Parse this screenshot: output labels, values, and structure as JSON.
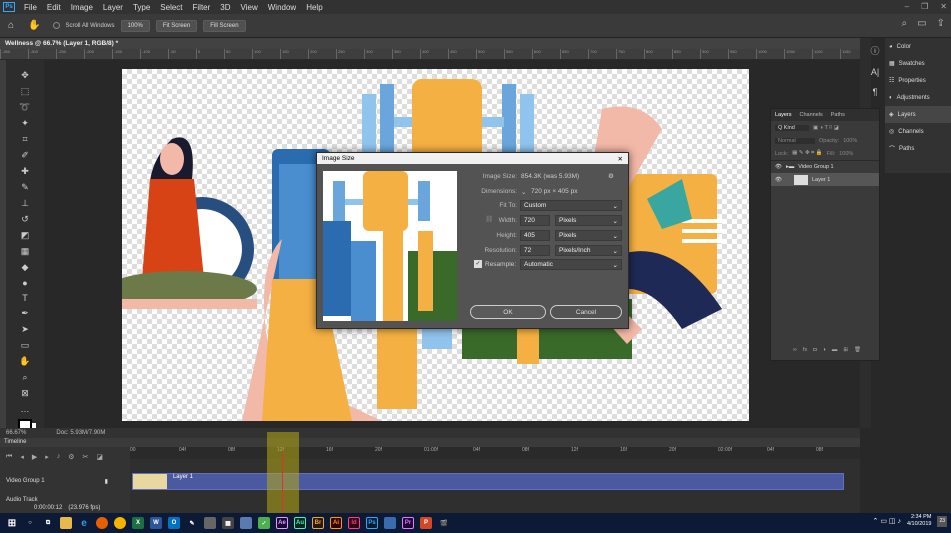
{
  "menubar": {
    "logo": "Ps",
    "items": [
      "File",
      "Edit",
      "Image",
      "Layer",
      "Type",
      "Select",
      "Filter",
      "3D",
      "View",
      "Window",
      "Help"
    ]
  },
  "options": {
    "scroll_all": "Scroll All Windows",
    "zoom_100": "100%",
    "fit_screen": "Fit Screen",
    "fill_screen": "Fill Screen"
  },
  "document": {
    "tab": "Wellness @ 66.7% (Layer 1, RGB/8) *",
    "zoom": "66.67%",
    "doc_info": "Doc: 5.93M/7.90M"
  },
  "ruler_ticks": [
    "-350",
    "-300",
    "-250",
    "-200",
    "-150",
    "-100",
    "-50",
    "0",
    "50",
    "100",
    "150",
    "200",
    "250",
    "300",
    "350",
    "400",
    "450",
    "500",
    "550",
    "600",
    "650",
    "700",
    "750",
    "800",
    "850",
    "900",
    "950",
    "1000",
    "1050",
    "1100",
    "1150",
    "1200",
    "1250",
    "1300",
    "1350",
    "1400",
    "1450",
    "1500",
    "1550",
    "1600",
    "1650",
    "1700",
    "1750",
    "1800",
    "1850",
    "1900",
    "1950",
    "2000",
    "2050",
    "2100",
    "2150",
    "2200"
  ],
  "dialog": {
    "title": "Image Size",
    "image_size_label": "Image Size:",
    "image_size_value": "854.3K (was 5.93M)",
    "dimensions_label": "Dimensions:",
    "dimensions_value": "720 px × 405 px",
    "fit_to_label": "Fit To:",
    "fit_to_value": "Custom",
    "width_label": "Width:",
    "width_value": "720",
    "width_unit": "Pixels",
    "height_label": "Height:",
    "height_value": "405",
    "height_unit": "Pixels",
    "resolution_label": "Resolution:",
    "resolution_value": "72",
    "resolution_unit": "Pixels/Inch",
    "resample_label": "Resample:",
    "resample_value": "Automatic",
    "ok": "OK",
    "cancel": "Cancel"
  },
  "panels": {
    "items": [
      "Color",
      "Swatches",
      "Properties",
      "Adjustments",
      "Layers",
      "Channels",
      "Paths"
    ]
  },
  "layers": {
    "tabs": [
      "Layers",
      "Channels",
      "Paths"
    ],
    "kind": "Q Kind",
    "blend": "Normal",
    "opacity_label": "Opacity:",
    "opacity": "100%",
    "lock_label": "Lock:",
    "fill_label": "Fill:",
    "fill": "100%",
    "group": "Video Group 1",
    "layer": "Layer 1"
  },
  "timeline": {
    "title": "Timeline",
    "track": "Video Group 1",
    "clip": "Layer 1",
    "audio": "Audio Track",
    "timecode": "0:00:00:12",
    "fps": "(23.976 fps)",
    "ticks": [
      "00",
      "04f",
      "08f",
      "12f",
      "16f",
      "20f",
      "01:00f",
      "04f",
      "08f",
      "12f",
      "16f",
      "20f",
      "02:00f",
      "04f",
      "08f"
    ]
  },
  "taskbar": {
    "apps": [
      "Ae",
      "Au",
      "Br",
      "Ai",
      "Id",
      "Ps",
      "Pr",
      "P"
    ],
    "time": "2:34 PM",
    "date": "4/10/2019",
    "notif": "23"
  },
  "colors": {
    "accent": "#31a8ff",
    "track": "#4b5aa0",
    "taskbar": "#0c1a35"
  }
}
